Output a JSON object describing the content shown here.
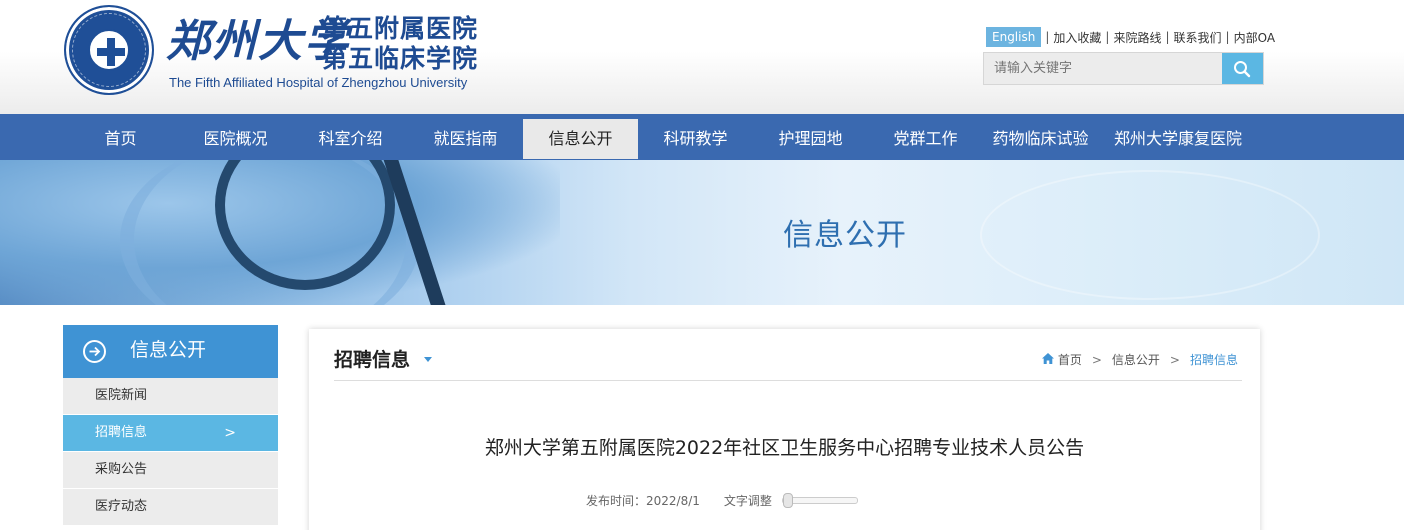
{
  "header": {
    "logo_zz": "郑州大学",
    "logo_line1": "第五附属医院",
    "logo_line2": "第五临床学院",
    "logo_en": "The Fifth Affiliated Hospital of Zhengzhou University"
  },
  "toplinks": {
    "english": "English",
    "sep": "|",
    "items": [
      "加入收藏",
      "来院路线",
      "联系我们",
      "内部OA"
    ]
  },
  "search": {
    "placeholder": "请输入关键字"
  },
  "nav": [
    "首页",
    "医院概况",
    "科室介绍",
    "就医指南",
    "信息公开",
    "科研教学",
    "护理园地",
    "党群工作",
    "药物临床试验",
    "郑州大学康复医院"
  ],
  "banner": {
    "title": "信息公开"
  },
  "sidebar": {
    "title": "信息公开",
    "items": [
      "医院新闻",
      "招聘信息",
      "采购公告",
      "医疗动态"
    ],
    "chevron": ">"
  },
  "main": {
    "section_title": "招聘信息",
    "breadcrumb": {
      "home": "首页",
      "sep": ">",
      "level1": "信息公开",
      "current": "招聘信息"
    },
    "article_title": "郑州大学第五附属医院2022年社区卫生服务中心招聘专业技术人员公告",
    "publish_label": "发布时间：2022/8/1",
    "font_adjust_label": "文字调整",
    "font_size_level": 0
  },
  "colors": {
    "nav_bg": "#3a69b0",
    "accent": "#3f93d4",
    "light_accent": "#5bb7e3",
    "brand": "#1e4b92"
  },
  "icons": [
    "hospital-seal-icon",
    "search-icon",
    "arrow-circle-icon",
    "chevron-right-icon",
    "home-icon",
    "dropdown-triangle-icon"
  ]
}
